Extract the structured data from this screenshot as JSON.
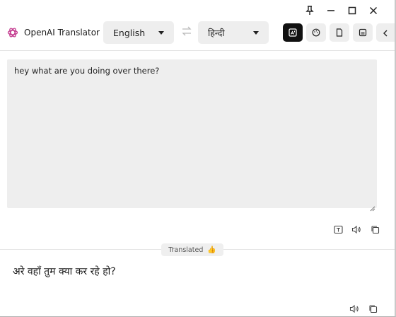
{
  "app": {
    "title": "OpenAI Translator",
    "logo_icon": "openai-logo-icon"
  },
  "window_controls": {
    "pin_icon": "pin-icon",
    "minimize_icon": "minimize-icon",
    "maximize_icon": "maximize-icon",
    "close_icon": "close-icon"
  },
  "languages": {
    "source": "English",
    "target": "हिन्दी",
    "swap_icon": "swap-icon"
  },
  "toolbar": {
    "buttons": [
      {
        "icon": "translate-mode-icon",
        "active": true
      },
      {
        "icon": "palette-icon",
        "active": false
      },
      {
        "icon": "document-icon",
        "active": false
      },
      {
        "icon": "history-icon",
        "active": false
      },
      {
        "icon": "chevron-left-icon",
        "active": false
      }
    ]
  },
  "source": {
    "text": "hey what are you doing over there?",
    "icons": [
      "word-mode-icon",
      "speaker-icon",
      "copy-icon"
    ]
  },
  "status": {
    "label": "Translated",
    "emoji": "👍"
  },
  "result": {
    "text": "अरे वहाँ तुम क्या कर रहे हो?",
    "icons": [
      "speaker-icon",
      "copy-icon"
    ]
  },
  "colors": {
    "active_button": "#111111",
    "control_bg": "#eeeeee",
    "text": "#222222"
  }
}
